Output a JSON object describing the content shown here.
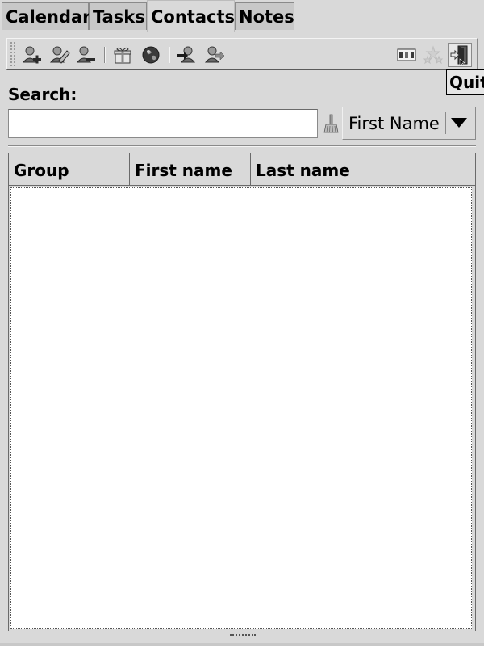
{
  "tabs": [
    {
      "label": "Calendar",
      "active": false
    },
    {
      "label": "Tasks",
      "active": false
    },
    {
      "label": "Contacts",
      "active": true
    },
    {
      "label": "Notes",
      "active": false
    }
  ],
  "toolbar": {
    "buttons": [
      {
        "icon": "add-contact-icon"
      },
      {
        "icon": "edit-contact-icon"
      },
      {
        "icon": "remove-contact-icon"
      },
      {
        "icon": "gift-icon"
      },
      {
        "icon": "globe-icon"
      },
      {
        "icon": "import-contact-icon"
      },
      {
        "icon": "export-contact-icon"
      },
      {
        "icon": "view-columns-icon"
      },
      {
        "icon": "stars-icon"
      },
      {
        "icon": "quit-icon"
      }
    ],
    "tooltip": "Quit"
  },
  "search": {
    "label": "Search:",
    "value": "",
    "placeholder": "",
    "field_select": {
      "selected": "First Name"
    }
  },
  "table": {
    "columns": [
      "Group",
      "First name",
      "Last name"
    ],
    "rows": []
  },
  "colors": {
    "window_bg": "#d9d9d9",
    "input_bg": "#ffffff",
    "border": "#8a8a8a"
  }
}
